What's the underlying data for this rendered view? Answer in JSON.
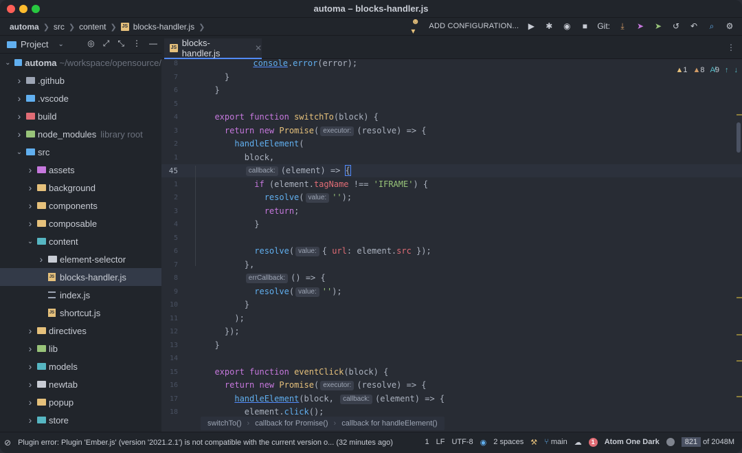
{
  "window": {
    "title": "automa – blocks-handler.js"
  },
  "navbar": {
    "breadcrumbs": [
      "automa",
      "src",
      "content",
      "blocks-handler.js"
    ],
    "add_configuration": "ADD CONFIGURATION...",
    "git_label": "Git:"
  },
  "project": {
    "title": "Project",
    "tree": [
      {
        "name": "automa",
        "extra": "~/workspace/opensource/",
        "depth": 0,
        "kind": "root",
        "expanded": true
      },
      {
        "name": ".github",
        "depth": 1,
        "kind": "folder",
        "color": "#9da5b4"
      },
      {
        "name": ".vscode",
        "depth": 1,
        "kind": "folder",
        "color": "#61afef"
      },
      {
        "name": "build",
        "depth": 1,
        "kind": "folder",
        "color": "#e06c75"
      },
      {
        "name": "node_modules",
        "extra": "library root",
        "depth": 1,
        "kind": "folder",
        "color": "#98c379"
      },
      {
        "name": "src",
        "depth": 1,
        "kind": "folder",
        "color": "#61afef",
        "expanded": true
      },
      {
        "name": "assets",
        "depth": 2,
        "kind": "folder",
        "color": "#c678dd"
      },
      {
        "name": "background",
        "depth": 2,
        "kind": "folder",
        "color": "#e5c07b"
      },
      {
        "name": "components",
        "depth": 2,
        "kind": "folder",
        "color": "#e5c07b"
      },
      {
        "name": "composable",
        "depth": 2,
        "kind": "folder",
        "color": "#e5c07b"
      },
      {
        "name": "content",
        "depth": 2,
        "kind": "folder",
        "color": "#56b6c2",
        "expanded": true
      },
      {
        "name": "element-selector",
        "depth": 3,
        "kind": "folder",
        "color": "#c8ccd4"
      },
      {
        "name": "blocks-handler.js",
        "depth": 3,
        "kind": "js",
        "selected": true
      },
      {
        "name": "index.js",
        "depth": 3,
        "kind": "index"
      },
      {
        "name": "shortcut.js",
        "depth": 3,
        "kind": "js"
      },
      {
        "name": "directives",
        "depth": 2,
        "kind": "folder",
        "color": "#e5c07b"
      },
      {
        "name": "lib",
        "depth": 2,
        "kind": "folder",
        "color": "#98c379"
      },
      {
        "name": "models",
        "depth": 2,
        "kind": "folder",
        "color": "#56b6c2"
      },
      {
        "name": "newtab",
        "depth": 2,
        "kind": "folder",
        "color": "#c8ccd4"
      },
      {
        "name": "popup",
        "depth": 2,
        "kind": "folder",
        "color": "#e5c07b"
      },
      {
        "name": "store",
        "depth": 2,
        "kind": "folder",
        "color": "#56b6c2"
      }
    ]
  },
  "editor": {
    "tab_label": "blocks-handler.js",
    "inspections": {
      "warnings": "1",
      "weak_warnings": "8",
      "typos": "9"
    },
    "line_numbers": [
      "8",
      "7",
      "6",
      "5",
      "4",
      "3",
      "2",
      "1",
      "45",
      "1",
      "2",
      "3",
      "4",
      "5",
      "6",
      "7",
      "8",
      "9",
      "10",
      "11",
      "12",
      "13",
      "14",
      "15",
      "16",
      "17",
      "18"
    ],
    "hints": {
      "executor": "executor:",
      "callback": "callback:",
      "value": "value:",
      "errCallback": "errCallback:"
    },
    "breadcrumbs": [
      "switchTo()",
      "callback for Promise()",
      "callback for handleElement()"
    ]
  },
  "status": {
    "message": "Plugin error: Plugin 'Ember.js' (version '2021.2.1') is not compatible with the current version o... (32 minutes ago)",
    "line": "1",
    "line_sep": "LF",
    "encoding": "UTF-8",
    "indent": "2 spaces",
    "branch": "main",
    "errors": "1",
    "theme": "Atom One Dark",
    "memory_used": "821",
    "memory_total": "of 2048M"
  }
}
